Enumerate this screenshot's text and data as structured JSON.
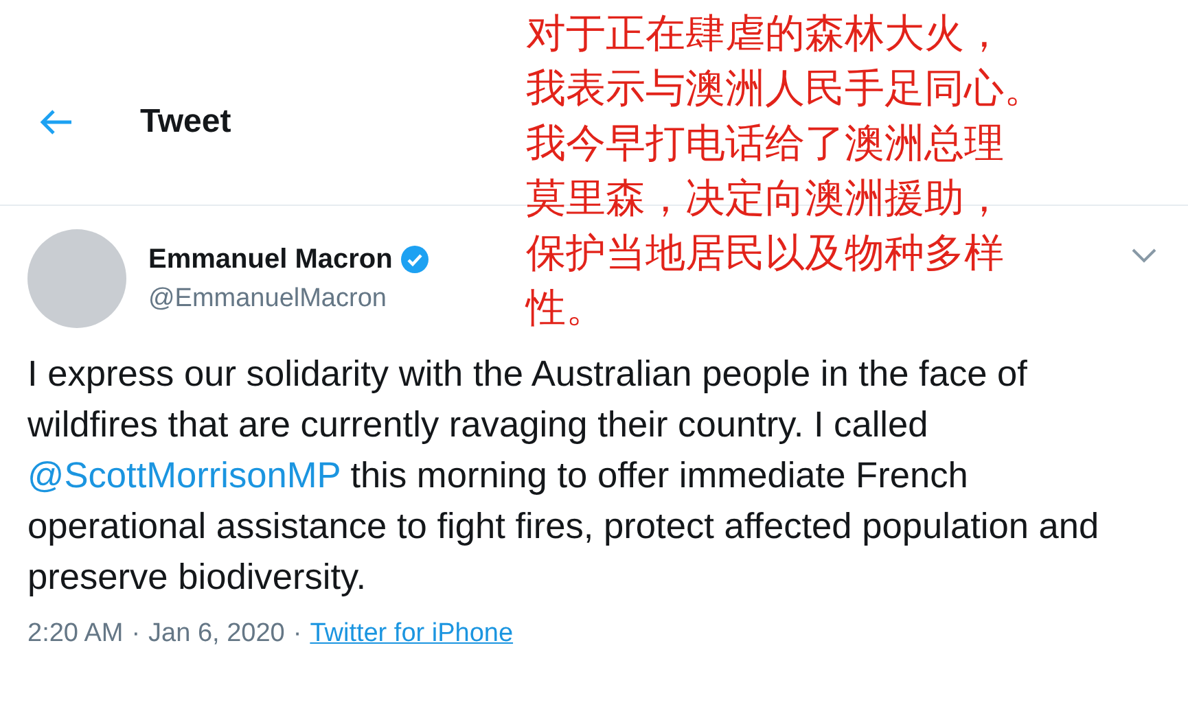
{
  "header": {
    "title": "Tweet"
  },
  "annotation": {
    "lines": [
      "对于正在肆虐的森林大火，",
      "我表示与澳洲人民手足同心。",
      "我今早打电话给了澳洲总理",
      "莫里森，决定向澳洲援助，",
      "保护当地居民以及物种多样",
      "性。"
    ]
  },
  "author": {
    "name": "Emmanuel Macron",
    "handle": "@EmmanuelMacron",
    "verified": true
  },
  "tweet": {
    "text_before": "I express our solidarity with the Australian people in the face of wildfires that are currently ravaging their country. I called ",
    "mention": "@ScottMorrisonMP",
    "text_after": " this morning to offer immediate French operational assistance to fight fires, protect affected population and preserve biodiversity."
  },
  "footer": {
    "time": "2:20 AM",
    "separator_1": "·",
    "date": "Jan 6, 2020",
    "separator_2": "·",
    "source": "Twitter for iPhone"
  }
}
